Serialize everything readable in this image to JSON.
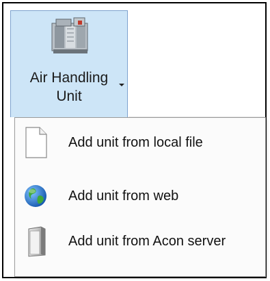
{
  "ribbon": {
    "button": {
      "label_line1": "Air Handling",
      "label_line2": "Unit",
      "icon": "air-handling-unit-icon",
      "state": "pressed",
      "highlight_color": "#cde5f7",
      "border_color": "#7da2ce"
    }
  },
  "menu": {
    "items": [
      {
        "label": "Add unit from local file",
        "icon": "blank-file-icon"
      },
      {
        "label": "Add unit from web",
        "icon": "globe-icon"
      },
      {
        "label": "Add unit from Acon server",
        "icon": "server-icon"
      }
    ]
  }
}
